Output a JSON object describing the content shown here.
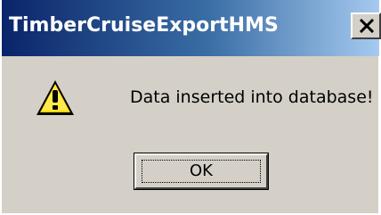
{
  "window": {
    "title": "TimberCruiseExportHMS",
    "close_icon": "close-icon",
    "title_gradient": [
      "#0a246a",
      "#a6caf0"
    ]
  },
  "dialog": {
    "icon": "warning-icon",
    "message": "Data inserted into database!",
    "ok_label": "OK",
    "background": "#d4d0c8"
  }
}
